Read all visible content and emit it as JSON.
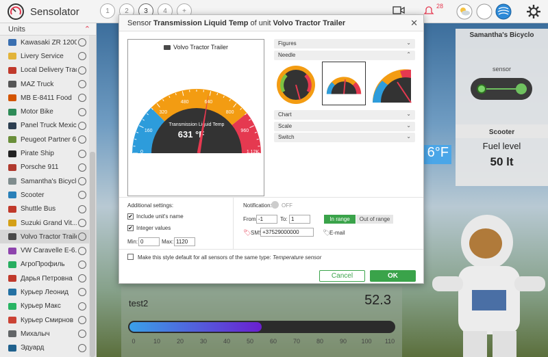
{
  "app": {
    "name": "Sensolator",
    "notification_count": "28"
  },
  "steps": [
    "1",
    "2",
    "3",
    "4",
    "+"
  ],
  "left_panel": {
    "title": "Units",
    "units": [
      {
        "name": "Kawasaki ZR 1200",
        "color": "#3a6fb0"
      },
      {
        "name": "Livery Service",
        "color": "#e2b43a"
      },
      {
        "name": "Local Delivery Track",
        "color": "#c0392b"
      },
      {
        "name": "MAZ Truck",
        "color": "#555555"
      },
      {
        "name": "MB E-8411 Food",
        "color": "#d35400"
      },
      {
        "name": "Motor Bike",
        "color": "#2e8b57"
      },
      {
        "name": "Panel Truck Mexico",
        "color": "#2c3e50"
      },
      {
        "name": "Peugeot Partner 6...",
        "color": "#6a8f3a"
      },
      {
        "name": "Pirate Ship",
        "color": "#222222"
      },
      {
        "name": "Porsche 911",
        "color": "#b03a2e"
      },
      {
        "name": "Samantha's Bicycle",
        "color": "#7f8c8d"
      },
      {
        "name": "Scooter",
        "color": "#2980b9"
      },
      {
        "name": "Shuttle Bus",
        "color": "#c0392b"
      },
      {
        "name": "Suzuki Grand Vit...",
        "color": "#d4a017"
      },
      {
        "name": "Volvo Tractor Trailer",
        "color": "#4a4a4a"
      },
      {
        "name": "VW Caravelle E-6...",
        "color": "#8e44ad"
      },
      {
        "name": "АгроПрофиль",
        "color": "#27ae60"
      },
      {
        "name": "Дарья Петровна",
        "color": "#c0392b"
      },
      {
        "name": "Курьер Леонид",
        "color": "#2471a3"
      },
      {
        "name": "Курьер Макс",
        "color": "#28b463"
      },
      {
        "name": "Курьер Смирнов",
        "color": "#cb4335"
      },
      {
        "name": "Михалыч",
        "color": "#626567"
      },
      {
        "name": "Эдуард",
        "color": "#1f618d"
      }
    ],
    "selected_index": 14
  },
  "dashboard": {
    "bicycle_title": "Samantha's Bicyclo",
    "bicycle_sensor": "sensor",
    "scooter_title": "Scooter",
    "scooter_label": "Fuel level",
    "scooter_value": "50 lt",
    "temp_fragment": "6°F",
    "bottom_label": "test2",
    "bottom_value": "52.3",
    "bar_value_fraction": 0.5,
    "ticks": [
      "0",
      "10",
      "20",
      "30",
      "40",
      "50",
      "60",
      "70",
      "80",
      "90",
      "100",
      "110"
    ]
  },
  "dialog": {
    "title_parts": [
      "Sensor ",
      "Transmission Liquid Temp",
      " of unit ",
      "Volvo Tractor Trailer"
    ],
    "preview": {
      "unit_name": "Volvo Tractor Trailer",
      "sensor_name": "Transmission Liquid Temp",
      "value_text": "631 °F",
      "value": 631,
      "min": 0,
      "max": 1120,
      "scale_labels": [
        "0",
        "160",
        "320",
        "480",
        "640",
        "800",
        "960",
        "1.12K"
      ]
    },
    "sections": {
      "figures": "Figures",
      "needle": "Needle",
      "chart": "Chart",
      "scale": "Scale",
      "switch": "Switch"
    },
    "additional_settings": "Additional settings:",
    "include_units_name": "Include unit's name",
    "integer_values": "Integer values",
    "min_label": "Min:",
    "min_value": "0",
    "max_label": "Max:",
    "max_value": "1120",
    "notification_label": "Notification:",
    "notification_state": "OFF",
    "from_label": "From:",
    "from_value": "-1",
    "to_label": "To:",
    "to_value": "1",
    "in_range": "In range",
    "out_of_range": "Out of range",
    "sms_label": "SMS",
    "sms_value": "+37529000000",
    "email_label": "E-mail",
    "default_style_text": "Make this style default for all sensors of the same type: ",
    "sensor_type": "Temperature sensor",
    "cancel": "Cancel",
    "ok": "OK"
  },
  "colors": {
    "accent_green": "#3aa34a",
    "brand_red": "#e53950"
  }
}
